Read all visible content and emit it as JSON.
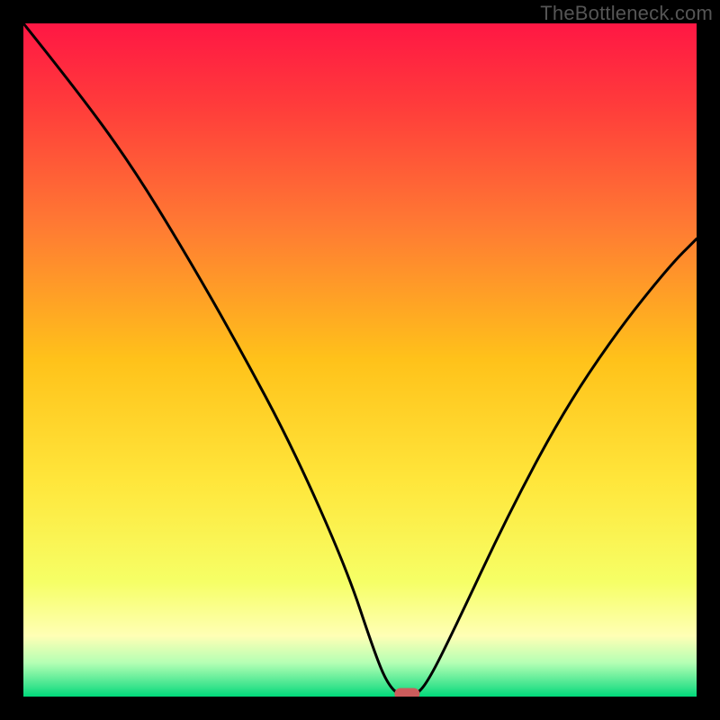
{
  "watermark": "TheBottleneck.com",
  "chart_data": {
    "type": "line",
    "title": "",
    "xlabel": "",
    "ylabel": "",
    "xlim": [
      0,
      100
    ],
    "ylim": [
      0,
      100
    ],
    "grid": false,
    "legend": false,
    "series": [
      {
        "name": "bottleneck-curve",
        "x": [
          0,
          8,
          16,
          24,
          32,
          40,
          48,
          52,
          54,
          56,
          58,
          60,
          64,
          72,
          80,
          88,
          96,
          100
        ],
        "y": [
          100,
          90,
          79,
          66,
          52,
          37,
          19,
          7,
          2,
          0,
          0,
          2,
          10,
          27,
          42,
          54,
          64,
          68
        ]
      }
    ],
    "marker": {
      "x": 57,
      "y": 0,
      "color": "#cd5c5c",
      "shape": "rounded-rect"
    },
    "background_gradient": {
      "stops": [
        {
          "pos": 0.0,
          "color": "#ff1744"
        },
        {
          "pos": 0.12,
          "color": "#ff3b3b"
        },
        {
          "pos": 0.3,
          "color": "#ff7a33"
        },
        {
          "pos": 0.5,
          "color": "#ffc21a"
        },
        {
          "pos": 0.68,
          "color": "#ffe63b"
        },
        {
          "pos": 0.83,
          "color": "#f6ff66"
        },
        {
          "pos": 0.91,
          "color": "#ffffb5"
        },
        {
          "pos": 0.95,
          "color": "#b4ffb4"
        },
        {
          "pos": 0.985,
          "color": "#3be48d"
        },
        {
          "pos": 1.0,
          "color": "#00d97a"
        }
      ]
    }
  }
}
